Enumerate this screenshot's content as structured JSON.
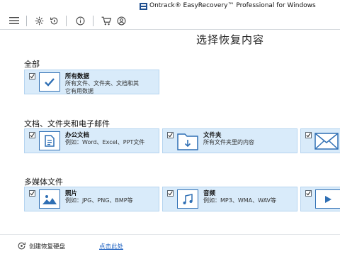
{
  "window": {
    "title": "Ontrack® EasyRecovery™ Professional for Windows"
  },
  "toolbar": {
    "icons": [
      "menu-icon",
      "gear-icon",
      "history-icon",
      "info-icon",
      "cart-icon",
      "account-icon"
    ]
  },
  "page": {
    "title": "选择恢复内容"
  },
  "sections": {
    "all": {
      "title": "全部",
      "card": {
        "label": "所有数据",
        "desc_line1": "所有文件、文件夹、文档和其",
        "desc_line2": "它有用数据",
        "checked": true
      }
    },
    "docs": {
      "title": "文档、文件夹和电子邮件",
      "cards": [
        {
          "label": "办公文档",
          "desc": "例如：Word、Excel、PPT文件",
          "checked": true
        },
        {
          "label": "文件夹",
          "desc": "所有文件夹里的内容",
          "checked": true
        },
        {
          "label": "电子邮件",
          "desc": "",
          "checked": true
        }
      ]
    },
    "media": {
      "title": "多媒体文件",
      "cards": [
        {
          "label": "照片",
          "desc": "例如：JPG、PNG、BMP等",
          "checked": true
        },
        {
          "label": "音频",
          "desc": "例如：MP3、WMA、WAV等",
          "checked": true
        },
        {
          "label": "视频",
          "desc": "",
          "checked": true
        }
      ]
    }
  },
  "footer": {
    "create_disk_label": "创建恢复硬盘",
    "click_here_label": "点击此处"
  },
  "colors": {
    "card_bg": "#d9ebfa",
    "card_border": "#b5d4f0",
    "icon_blue": "#2f6fb4",
    "link": "#1a5fc0"
  }
}
